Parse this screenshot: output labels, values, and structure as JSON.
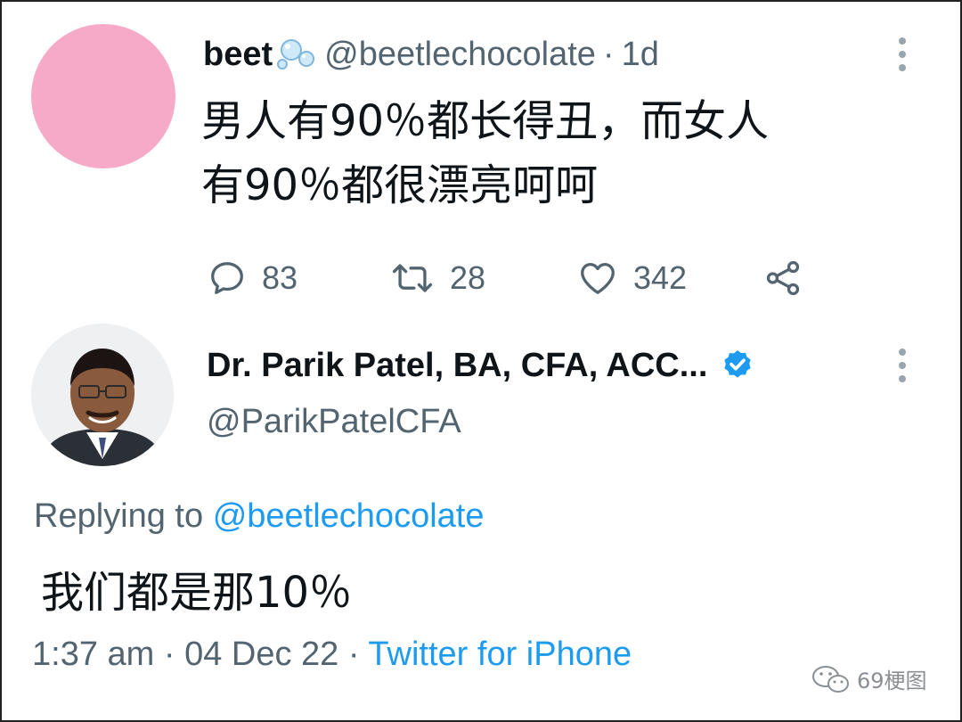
{
  "tweet1": {
    "name": "beet",
    "handle": "@beetlechocolate",
    "separator": "·",
    "time": "1d",
    "text_line1": "男人有90％都长得丑，而女人",
    "text_line2": "有90％都很漂亮呵呵",
    "replies": "83",
    "retweets": "28",
    "likes": "342",
    "avatar_color": "#f7aac8"
  },
  "tweet2": {
    "name": "Dr. Parik Patel, BA, CFA, ACC...",
    "handle": "@ParikPatelCFA",
    "replying_prefix": "Replying to",
    "replying_handle": "@beetlechocolate",
    "text": "我们都是那10％",
    "time": "1:37 am",
    "date": "04 Dec 22",
    "separator": "·",
    "source": "Twitter for iPhone",
    "verified_color": "#1d9bf0"
  },
  "watermark": {
    "text": "69梗图",
    "icon": "wechat-icon"
  },
  "colors": {
    "text_primary": "#0f1419",
    "text_secondary": "#536471",
    "link": "#1d9bf0"
  }
}
